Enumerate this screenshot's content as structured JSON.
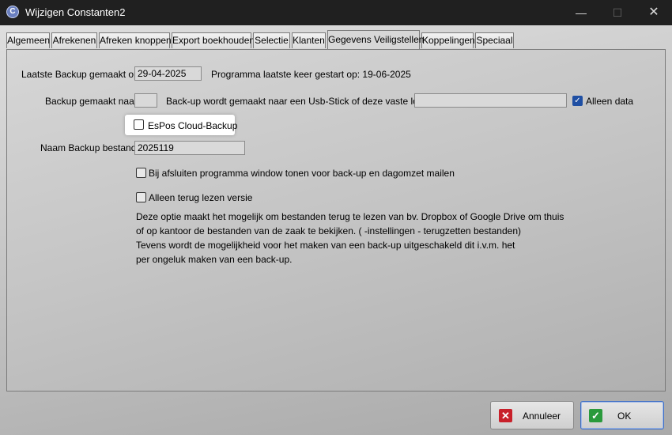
{
  "window": {
    "title": "Wijzigen Constanten2",
    "minimize": "—",
    "maximize": "☐",
    "close": "✕",
    "icon_glyph": "C"
  },
  "tabs": [
    {
      "label": "Algemeen"
    },
    {
      "label": "Afrekenen"
    },
    {
      "label": "Afreken knoppen"
    },
    {
      "label": "Export boekhouden"
    },
    {
      "label": "Selectie"
    },
    {
      "label": "Klanten"
    },
    {
      "label": "Gegevens Veiligstellen"
    },
    {
      "label": "Koppelingen"
    },
    {
      "label": "Speciaal"
    }
  ],
  "active_tab": "Gegevens Veiligstellen",
  "form": {
    "last_backup_label": "Laatste Backup gemaakt op",
    "last_backup_value": "29-04-2025",
    "program_started": "Programma laatste keer gestart op: 19-06-2025",
    "backup_to_label": "Backup gemaakt naar",
    "backup_to_value": "",
    "backup_location_text": "Back-up wordt gemaakt naar een Usb-Stick of deze vaste locatie:",
    "backup_location_value": "",
    "only_data_label": "Alleen data",
    "only_data_checked": true,
    "cloud_backup_label": "EsPos Cloud-Backup",
    "cloud_backup_checked": false,
    "backup_name_label": "Naam Backup bestand",
    "backup_name_value": "2025119",
    "show_window_label": "Bij afsluiten programma window tonen voor back-up en dagomzet mailen",
    "show_window_checked": false,
    "read_only_label": "Alleen terug lezen versie",
    "read_only_checked": false,
    "info_lines": [
      "Deze optie maakt het mogelijk om bestanden terug te lezen van bv. Dropbox of Google Drive om thuis",
      "of op kantoor de bestanden van de zaak te bekijken. ( -instellingen - terugzetten bestanden)",
      "Tevens wordt de mogelijkheid voor het maken van een back-up uitgeschakeld dit i.v.m. het",
      "per ongeluk maken van een back-up."
    ]
  },
  "buttons": {
    "cancel_label": "Annuleer",
    "cancel_icon": "✕",
    "ok_label": "OK",
    "ok_icon": "✓"
  },
  "colors": {
    "cancel_icon": "#c8202a",
    "ok_icon": "#2a9a3c",
    "checkbox_checked": "#1f4fa3"
  }
}
